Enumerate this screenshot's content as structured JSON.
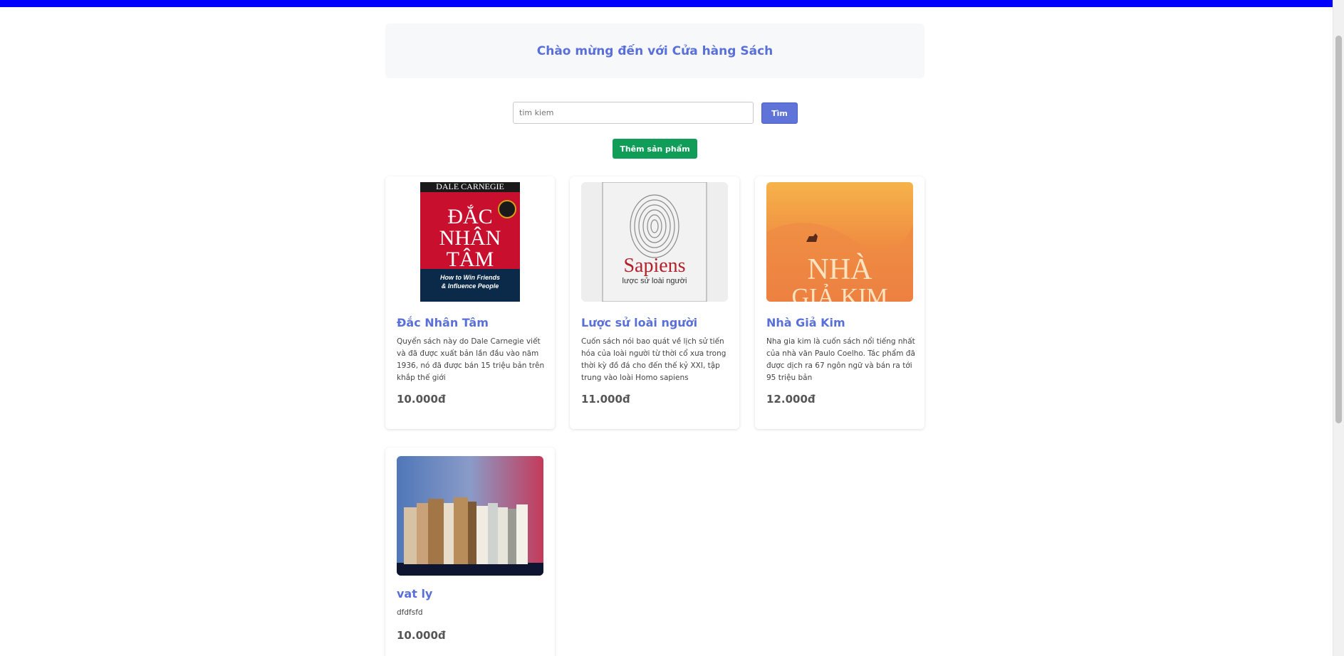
{
  "header": {
    "title": "Chào mừng đến với Cửa hàng Sách"
  },
  "search": {
    "placeholder": "tim kiem",
    "value": "tim kiem",
    "button_label": "Tìm"
  },
  "actions": {
    "add_product_label": "Thêm sản phẩm"
  },
  "products": [
    {
      "title": "Đắc Nhân Tâm",
      "description": "Quyển sách này do Dale Carnegie viết và đã được xuất bản lần đầu vào năm 1936, nó đã được bán 15 triệu bản trên khắp thế giới",
      "price": "10.000đ",
      "cover_text": {
        "author": "DALE CARNEGIE",
        "line1": "ĐẮC",
        "line2": "NHÂN",
        "line3": "TÂM",
        "subtitle": "How to Win Friends & Influence People"
      }
    },
    {
      "title": "Lược sử loài người",
      "description": "Cuốn sách nói bao quát về lịch sử tiến hóa của loài người từ thời cổ xưa trong thời kỳ đồ đá cho đến thế kỷ XXI, tập trung vào loài Homo sapiens",
      "price": "11.000đ",
      "cover_text": {
        "title": "Sapiens",
        "subtitle": "lược sử loài người"
      }
    },
    {
      "title": "Nhà Giả Kim",
      "description": "Nha gia kim là cuốn sách nổi tiếng nhất của nhà văn Paulo Coelho. Tác phẩm đã được dịch ra 67 ngôn ngữ và bán ra tới 95 triệu bản",
      "price": "12.000đ",
      "cover_text": {
        "line1": "NHÀ",
        "line2": "GIẢ KIM"
      }
    },
    {
      "title": "vat ly",
      "description": "dfdfsfd",
      "price": "10.000đ"
    }
  ],
  "colors": {
    "top_bar": "#0000ff",
    "accent": "#5a70d9",
    "add_button": "#0f9d58"
  }
}
